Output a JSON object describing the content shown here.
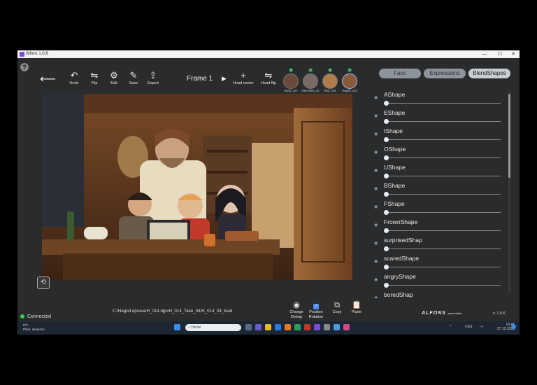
{
  "window": {
    "title": "Alfons 1.0.6",
    "controls": [
      "—",
      "☐",
      "✕"
    ]
  },
  "toolbar": {
    "help": "?",
    "back_icon": "arrow-left-icon",
    "tools": [
      {
        "label": "Undo",
        "glyph": "↶"
      },
      {
        "label": "Flip",
        "glyph": "⇋"
      },
      {
        "label": "Edit",
        "glyph": "⚙"
      },
      {
        "label": "Save",
        "glyph": "✎"
      },
      {
        "label": "Export",
        "glyph": "⇪"
      }
    ],
    "frame_label": "Frame 1",
    "play_glyph": "▶",
    "head_center": {
      "label": "Head center",
      "glyph": "+"
    },
    "head_flip": {
      "label": "Head flip",
      "glyph": "⇋"
    }
  },
  "characters": [
    {
      "name": "Harry_v07",
      "color": "#6a4a3a"
    },
    {
      "name": "Hermione_v0",
      "color": "#7a6a66"
    },
    {
      "name": "Ron_v03",
      "color": "#b07a4a"
    },
    {
      "name": "Hagrid_v03",
      "color": "#8a5a3a",
      "selected": true
    }
  ],
  "tabs": [
    {
      "label": "Face",
      "active": false
    },
    {
      "label": "Expressions",
      "active": false
    },
    {
      "label": "BlendShapes",
      "active": true
    }
  ],
  "blendshapes": [
    {
      "name": "AShape",
      "value": 0
    },
    {
      "name": "EShape",
      "value": 0
    },
    {
      "name": "IShape",
      "value": 0
    },
    {
      "name": "OShape",
      "value": 0
    },
    {
      "name": "UShape",
      "value": 0
    },
    {
      "name": "BShape",
      "value": 0
    },
    {
      "name": "FShape",
      "value": 0
    },
    {
      "name": "FrownShape",
      "value": 0
    },
    {
      "name": "surprisedShap",
      "value": 0
    },
    {
      "name": "scaredShape",
      "value": 0
    },
    {
      "name": "angryShape",
      "value": 0
    },
    {
      "name": "boredShap",
      "value": 0
    }
  ],
  "status": {
    "text": "Connected",
    "color": "#3ecf4a"
  },
  "file_path": "C:/Hagrid oprava/H_014.dgn/H_014_Take_04/H_014_04_feed",
  "bottom_tools": [
    {
      "label": "Change\nDebug",
      "glyph": "◉"
    },
    {
      "label": "Position\nRotation",
      "glyph": "✓"
    },
    {
      "label": "Copy",
      "glyph": "⧉"
    },
    {
      "label": "Paste",
      "glyph": "📋"
    }
  ],
  "brand": {
    "name": "ALFONS",
    "tagline": "pose editor",
    "version": "v. 1.0.6"
  },
  "taskbar": {
    "weather_temp": "8°C",
    "weather_text": "Převl. slunečno",
    "search_placeholder": "Hledat",
    "tray_lang": "CES",
    "time": "10:41",
    "date": "27.12.2023"
  }
}
